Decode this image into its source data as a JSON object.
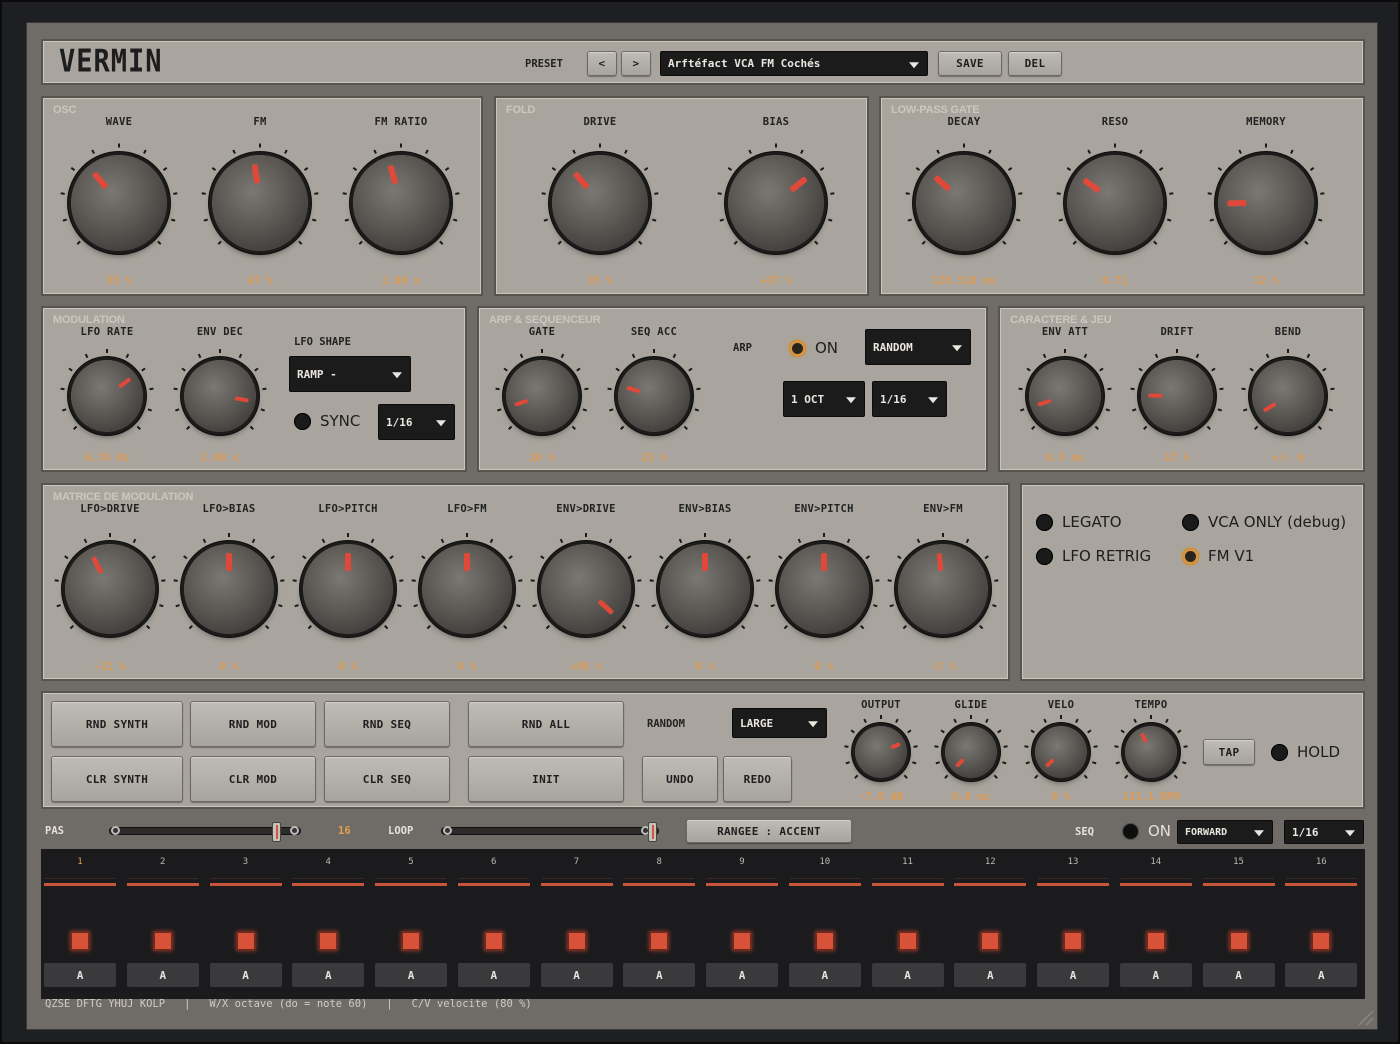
{
  "app": {
    "title": "VERMIN"
  },
  "header": {
    "preset_label": "PRESET",
    "prev": "<",
    "next": ">",
    "preset_name": "Arftéfact VCA FM Cochés",
    "save": "SAVE",
    "del": "DEL"
  },
  "osc": {
    "title": "OSC",
    "knobs": [
      {
        "label": "WAVE",
        "value": "35 %",
        "level": 0.35
      },
      {
        "label": "FM",
        "value": "47 %",
        "level": 0.47
      },
      {
        "label": "FM RATIO",
        "value": "2.00 x",
        "level": 0.44
      }
    ]
  },
  "fold": {
    "title": "FOLD",
    "knobs": [
      {
        "label": "DRIVE",
        "value": "35 %",
        "level": 0.35
      },
      {
        "label": "BIAS",
        "value": "+37 %",
        "level": 0.69
      }
    ]
  },
  "lpg": {
    "title": "LOW-PASS GATE",
    "knobs": [
      {
        "label": "DECAY",
        "value": "120.518 ms",
        "level": 0.32
      },
      {
        "label": "RESO",
        "value": "0.71",
        "level": 0.3
      },
      {
        "label": "MEMORY",
        "value": "12 %",
        "level": 0.16
      }
    ]
  },
  "mod": {
    "title": "MODULATION",
    "knobs": [
      {
        "label": "LFO RATE",
        "value": "6.74 Hz",
        "level": 0.7
      },
      {
        "label": "ENV DEC",
        "value": "2.98 s",
        "level": 0.87
      }
    ],
    "lfo_shape_label": "LFO SHAPE",
    "lfo_shape": "RAMP -",
    "sync_label": "SYNC",
    "sync_div": "1/16"
  },
  "arp": {
    "title": "ARP & SEQUENCEUR",
    "knobs": [
      {
        "label": "GATE",
        "value": "10 %",
        "level": 0.1
      },
      {
        "label": "SEQ ACC",
        "value": "23 %",
        "level": 0.23
      }
    ],
    "arp_label": "ARP",
    "on_label": "ON",
    "mode": "RANDOM",
    "octave": "1 OCT",
    "division": "1/16"
  },
  "char": {
    "title": "CARACTERE & JEU",
    "knobs": [
      {
        "label": "ENV ATT",
        "value": "0.5 ms",
        "level": 0.1
      },
      {
        "label": "DRIFT",
        "value": "17 %",
        "level": 0.17
      },
      {
        "label": "BEND",
        "value": "+/- 0",
        "level": 0.05
      }
    ]
  },
  "matrix": {
    "title": "MATRICE DE MODULATION",
    "knobs": [
      {
        "label": "LFO>DRIVE",
        "value": "-21 %",
        "level": 0.4
      },
      {
        "label": "LFO>BIAS",
        "value": "0 %",
        "level": 0.5
      },
      {
        "label": "LFO>PITCH",
        "value": "0 %",
        "level": 0.5
      },
      {
        "label": "LFO>FM",
        "value": "0 %",
        "level": 0.5
      },
      {
        "label": "ENV>DRIVE",
        "value": "+98 %",
        "level": 0.99
      },
      {
        "label": "ENV>BIAS",
        "value": "0 %",
        "level": 0.5
      },
      {
        "label": "ENV>PITCH",
        "value": "0 %",
        "level": 0.5
      },
      {
        "label": "ENV>FM",
        "value": "-5 %",
        "level": 0.48
      }
    ]
  },
  "options": {
    "legato": "LEGATO",
    "vca_only": "VCA ONLY (debug)",
    "lfo_retrig": "LFO RETRIG",
    "fm_v1": "FM V1"
  },
  "actions": {
    "rnd_synth": "RND SYNTH",
    "rnd_mod": "RND MOD",
    "rnd_seq": "RND SEQ",
    "rnd_all": "RND ALL",
    "clr_synth": "CLR SYNTH",
    "clr_mod": "CLR MOD",
    "clr_seq": "CLR SEQ",
    "init": "INIT",
    "random_label": "RANDOM",
    "random_amount": "LARGE",
    "undo": "UNDO",
    "redo": "REDO"
  },
  "master": {
    "knobs": [
      {
        "label": "OUTPUT",
        "value": "-7.0 dB",
        "level": 0.75
      },
      {
        "label": "GLIDE",
        "value": "0.0 ms",
        "level": 0.0
      },
      {
        "label": "VELO",
        "value": "0 %",
        "level": 0.0
      },
      {
        "label": "TEMPO",
        "value": "133.1 BPM",
        "level": 0.4
      }
    ],
    "tap": "TAP",
    "hold": "HOLD"
  },
  "seqbar": {
    "pas_label": "PAS",
    "pas_value": "16",
    "pas_level": 0.9,
    "loop_label": "LOOP",
    "loop_level": 1.0,
    "range_button": "RANGEE : ACCENT",
    "seq_label": "SEQ",
    "on_label": "ON",
    "direction": "FORWARD",
    "division": "1/16"
  },
  "steps": [
    {
      "n": "1",
      "acc": "A"
    },
    {
      "n": "2",
      "acc": "A"
    },
    {
      "n": "3",
      "acc": "A"
    },
    {
      "n": "4",
      "acc": "A"
    },
    {
      "n": "5",
      "acc": "A"
    },
    {
      "n": "6",
      "acc": "A"
    },
    {
      "n": "7",
      "acc": "A"
    },
    {
      "n": "8",
      "acc": "A"
    },
    {
      "n": "9",
      "acc": "A"
    },
    {
      "n": "10",
      "acc": "A"
    },
    {
      "n": "11",
      "acc": "A"
    },
    {
      "n": "12",
      "acc": "A"
    },
    {
      "n": "13",
      "acc": "A"
    },
    {
      "n": "14",
      "acc": "A"
    },
    {
      "n": "15",
      "acc": "A"
    },
    {
      "n": "16",
      "acc": "A"
    }
  ],
  "footer": {
    "keys": "QZSE DFTG YHUJ KOLP   |   W/X octave (do = note 60)   |   C/V velocite (80 %)"
  }
}
